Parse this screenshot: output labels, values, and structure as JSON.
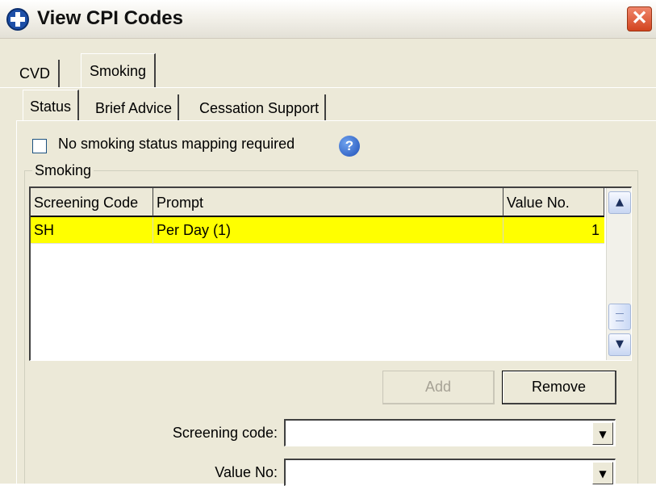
{
  "window": {
    "title": "View CPI Codes",
    "close_glyph": "✕"
  },
  "top_tabs": [
    {
      "label": "CVD"
    },
    {
      "label": "Smoking"
    }
  ],
  "sub_tabs": [
    {
      "label": "Status"
    },
    {
      "label": "Brief Advice"
    },
    {
      "label": "Cessation Support"
    }
  ],
  "status": {
    "no_mapping_checkbox": {
      "label": "No smoking status mapping required",
      "checked": false
    },
    "help_glyph": "?"
  },
  "smoking_group": {
    "label": "Smoking",
    "columns": [
      "Screening Code",
      "Prompt",
      "Value No."
    ],
    "rows": [
      {
        "screening_code": "SH",
        "prompt": "Per Day (1)",
        "value_no": "1"
      }
    ],
    "scroll_up_glyph": "▲",
    "scroll_down_glyph": "▼"
  },
  "buttons": {
    "add": "Add",
    "remove": "Remove"
  },
  "form": {
    "screening_code_label": "Screening code:",
    "screening_code_value": "",
    "value_no_label": "Value No:",
    "value_no_value": "",
    "dropdown_glyph": "▼"
  },
  "colors": {
    "selected_row": "#ffff00",
    "panel_bg": "#ece9d8",
    "close_button": "#d2441f",
    "help_icon": "#1f50b8"
  },
  "icons": {
    "app": "medical-cross-icon",
    "close": "close-icon",
    "help": "help-icon"
  }
}
